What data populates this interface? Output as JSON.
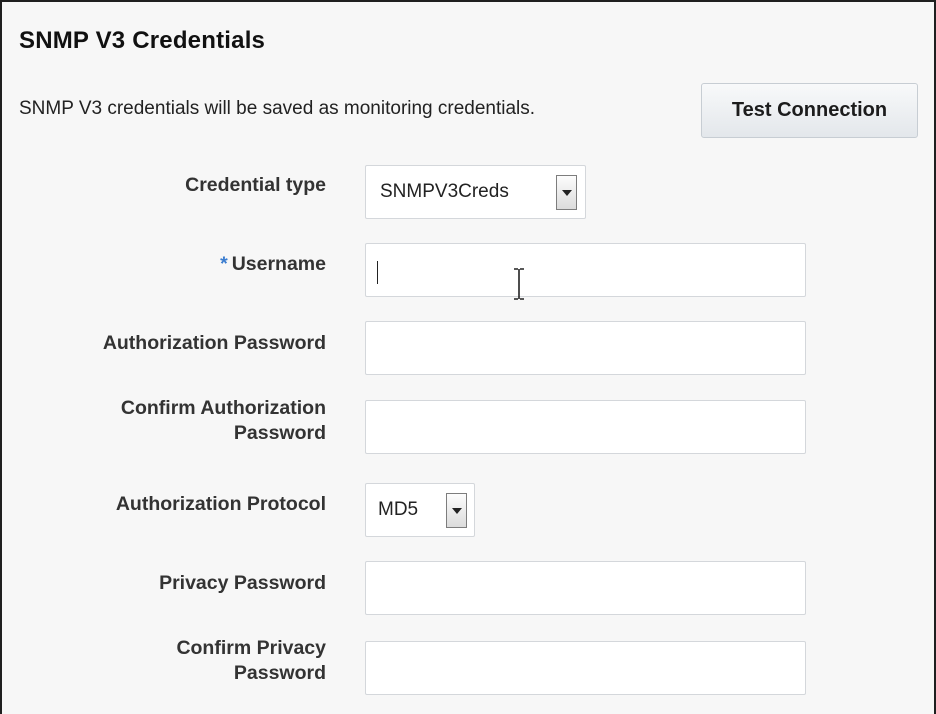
{
  "section": {
    "title": "SNMP V3 Credentials",
    "info": "SNMP V3 credentials will be saved as monitoring credentials.",
    "test_button_label": "Test Connection"
  },
  "form": {
    "credential_type": {
      "label": "Credential type",
      "selected_value": "SNMPV3Creds"
    },
    "username": {
      "required_marker": "*",
      "label": "Username",
      "value": ""
    },
    "authorization_password": {
      "label": "Authorization Password",
      "value": ""
    },
    "confirm_authorization_password": {
      "label_line1": "Confirm Authorization",
      "label_line2": "Password",
      "value": ""
    },
    "authorization_protocol": {
      "label": "Authorization Protocol",
      "selected_value": "MD5"
    },
    "privacy_password": {
      "label": "Privacy Password",
      "value": ""
    },
    "confirm_privacy_password": {
      "label_line1": "Confirm Privacy",
      "label_line2": "Password",
      "value": ""
    }
  },
  "icons": {
    "dropdown": "chevron-down-icon",
    "cursor": "text-cursor-icon"
  },
  "colors": {
    "required_marker": "#3a7ccf",
    "panel_background": "#f7f7f7",
    "panel_border": "#1f1f1f"
  }
}
